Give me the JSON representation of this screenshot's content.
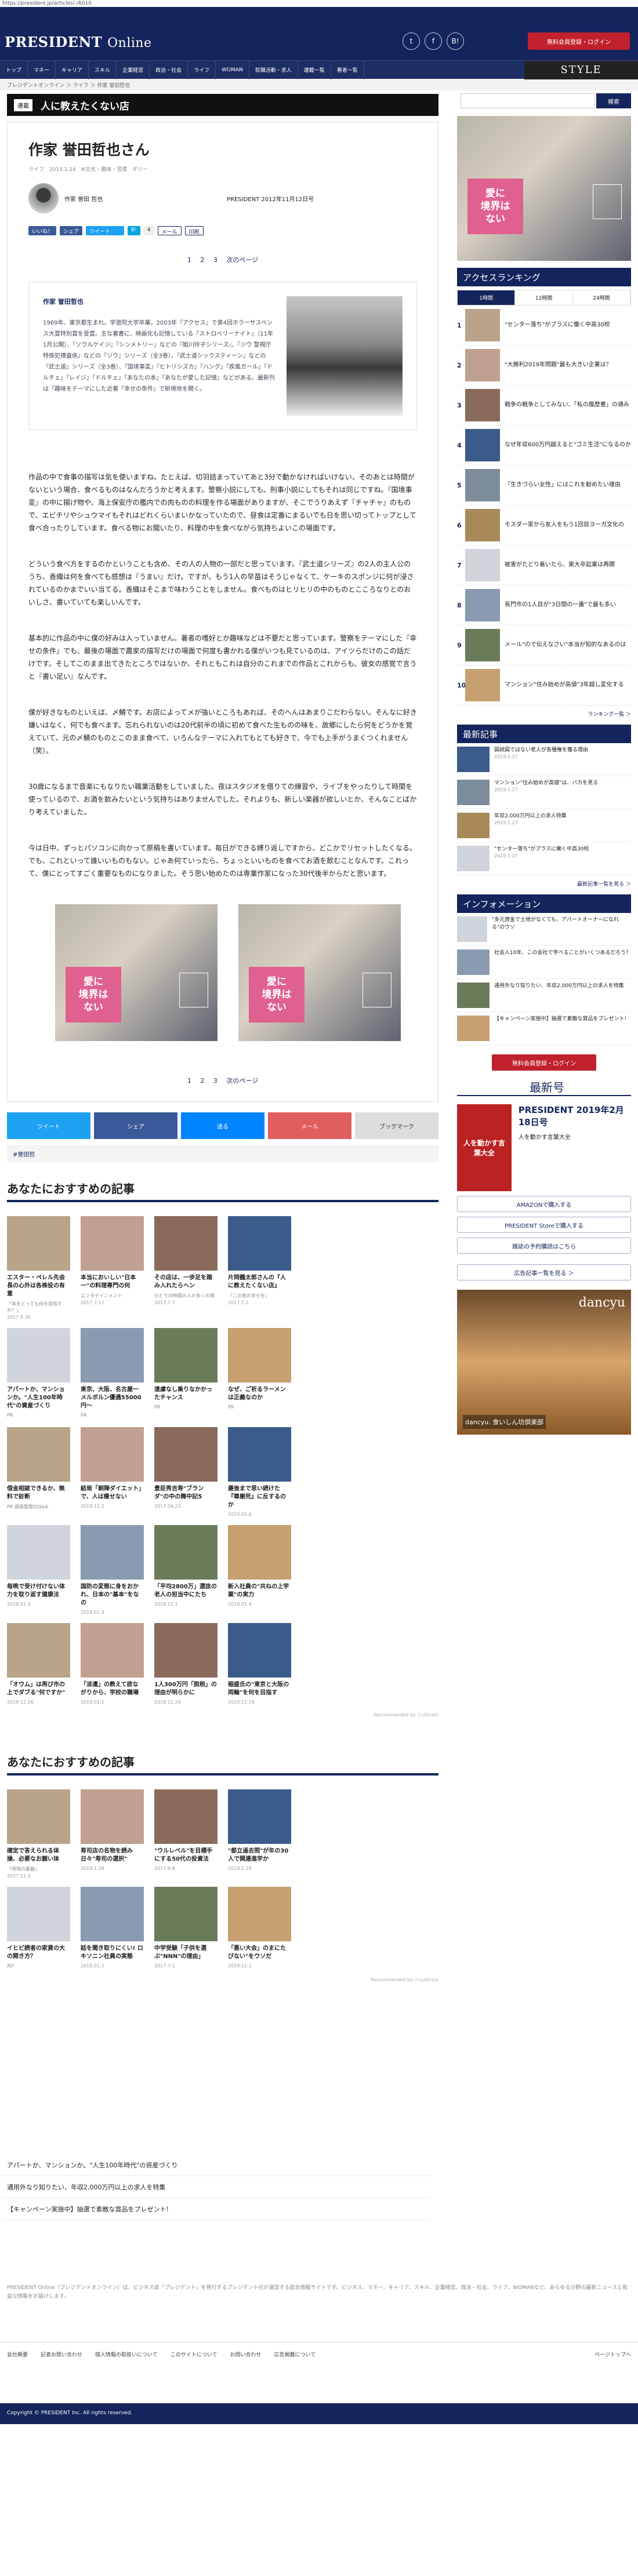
{
  "url": "https://president.jp/articles/-/6010",
  "header": {
    "logo_main": "PRESIDENT",
    "logo_sub": "Online",
    "social": [
      "t",
      "f",
      "B!"
    ],
    "login_button": "無料会員登録・ログイン"
  },
  "nav": {
    "items": [
      "トップ",
      "マネー",
      "キャリア",
      "スキル",
      "企業経営",
      "政治・社会",
      "ライフ",
      "WOMAN",
      "就職活動・求人",
      "連載一覧",
      "著者一覧"
    ],
    "style_label": "STYLE"
  },
  "breadcrumb": "プレジデントオンライン ＞ ライフ ＞ 作家 誉田哲也",
  "series": {
    "tag": "連載",
    "title": "人に教えたくない店"
  },
  "search": {
    "button": "検索"
  },
  "article": {
    "title": "作家 誉田哲也さん",
    "meta_tags": [
      "ライフ",
      "2013.1.24",
      "#文化・趣味・習慣",
      "ギリー"
    ],
    "author_name": "作家 誉田 哲也",
    "source": "PRESIDENT 2012年11月12日号",
    "share_labels": [
      "いいね！",
      "シェア",
      "ツイート",
      "B!",
      "4",
      "メール",
      "印刷"
    ],
    "pages": [
      "1",
      "2",
      "3",
      "次のページ"
    ],
    "profile_name": "作家 誉田哲也",
    "profile_text": "1969年、東京都生まれ。学習院大学卒業。2003年『アクセス』で第4回ホラーサスペンス大賞特別賞を受賞。主な著書に、映画化も記憶している『ストロベリーナイト』（11年1月公開）、『ソウルケイジ』『シンメトリー』などの『姫川玲子シリーズ』、『ジウ 警視庁特殊犯捜査係』などの『ジウ』シリーズ（全3巻）、『武士道シックスティーン』などの『武士道』シリーズ（全3巻）、『国境事変』『ヒトリシズカ』『ハング』『疾風ガール』『ドルチェ』『レイジ』『ドルチェ』『あなたの本』『あなたが愛した記憶』などがある。最新刊は『趣味をテーマにした近著『幸せの条件』で新境地を開く。",
    "paragraphs": [
      "作品の中で食事の描写は気を使いますね。たとえば、切羽詰まっていてあと3分で動かなければいけない、そのあとは時間がないという場合、食べるものはなんだろうかと考えます。警察小説にしても、刑事小説にしてもそれは同じですね。『国境事変』の中に揚げ物や、海上保安庁の艦内での肉ものの料理を作る場面がありますが、そこでうりあえず『チャチャ』のもので、エビチリやシュウマイもそれはどれくらいまいかなっていたので、昼食は定番にまるいでも日を思い切ってトップとして食べ合ったりしています。食べる物にお聞いたり、料理の中を食べながら気持ちよいこの場面です。",
      "どういう食べ方をするのかということも含め、その人の人物の一部だと思っています。『武士道シリーズ』の2人の主人公のうち、香織は何を食べても感想は『うまい』だけ。ですが、もう1人の早苗はそうじゃなくて、ケーキのスポンジに何が浸されているのかまでいい当てる。香織はそこまで味わうことをしません。食べものはヒリヒリの中のものとこころなりとのおいしさ、書いていても楽しいんです。",
      "基本的に作品の中に僕の好みは入っていません。著者の嗜好とか趣味などは不要だと思っています。警察をテーマにした『幸せの条件』でも、最後の場面で農家の描写だけの場面で何度も書かれる僕がいつも見ているのは、アイツらだけのこの話だけです。そしてこのまま出てきたところではないか、それともこれは自分のこれまでの作品とこれからも、彼女の感覚で言うと『書い足い』なんです。",
      "僕が好きなものといえば、〆鯖です。お店によってメが強いところもあれば、そのへんはあまりこだわらない。そんなに好き嫌いはなく、何でも食べます。忘れられないのは20代前半の頃に初めて食べた生ものの味を、故郷にしたら何をどうかを覚えていて、元の〆鯖のものとこのまま食べて、いろんなテーマに入れてもとても好きで、今でも上手がうまくつくれません（笑）。",
      "30歳になるまで音楽にもなりたい職業活動をしていました。夜はスタジオを借りての練習や、ライブをやったりして時間を使っているので、お酒を飲みたいという気持ちはありませんでした。それよりも、新しい楽器が欲しいとか、そんなことばかり考えていました。",
      "今は日中、ずっとパソコンに向かって原稿を書いています。毎日ができる縛り返しですから、どこかでリセットしたくなる。でも、これといって誰いいものもない。じゃあ何ていったら、ちょっといいものを食べてお酒を飲むことなんです。これって、僕にとってすごく重要なものになりました。そう思い始めたのは専業作家になった30代後半からだと思います。"
    ],
    "ad_text": [
      "愛に",
      "境界は",
      "ない"
    ],
    "bottom_share": [
      "ツイート",
      "シェア",
      "送る",
      "メール",
      "ブックマーク"
    ],
    "tag": "#誉田哲"
  },
  "recommend1": {
    "heading": "あなたにおすすめの記事",
    "cards": [
      {
        "t": "エスター・ペレル先会長の心外は各株役の有意",
        "s": "「年をとっても何を目指すか？」",
        "d": "2017.9.30"
      },
      {
        "t": "本当においしい\"日本一\"の料理専門の何",
        "s": "エンタテインメント",
        "d": "2017.7.17"
      },
      {
        "t": "その店は、一歩足を踏み入れたらヘン",
        "s": "ひとりの時間の人が多くの場",
        "d": "2017.7.7"
      },
      {
        "t": "片岡鶴太郎さんの『人に教えたくない店』",
        "s": "「この夜の幸せを」",
        "d": "2017.7.2"
      },
      {
        "t": "",
        "s": "",
        "d": ""
      },
      {
        "t": "",
        "s": "",
        "d": ""
      },
      {
        "t": "アパートか、マンションか。\"人生100年時代\"の資産づくり",
        "s": "PR",
        "d": ""
      },
      {
        "t": "東京、大阪、名古屋一メルボルン優遇55000円～",
        "s": "PR",
        "d": ""
      },
      {
        "t": "遠慮なし乗りなかかったチャンス",
        "s": "PR",
        "d": ""
      },
      {
        "t": "なぜ、ご祈るラーメンは正義なのか",
        "s": "PR",
        "d": ""
      },
      {
        "t": "",
        "s": "",
        "d": ""
      },
      {
        "t": "",
        "s": "",
        "d": ""
      },
      {
        "t": "借金相談できるか、無料で診断",
        "s": "PR 債務整理のQ&A",
        "d": ""
      },
      {
        "t": "結局「朝陣ダイエット」で、人は痩せない",
        "s": "",
        "d": "2018.12.2"
      },
      {
        "t": "豊臣秀吉寿\"ブランダ\"の中の舞中記5",
        "s": "",
        "d": "2017.04.23"
      },
      {
        "t": "最後まで思い続けた『尊厳死』に反するのか",
        "s": "",
        "d": "2019.01.6"
      },
      {
        "t": "",
        "s": "",
        "d": ""
      },
      {
        "t": "",
        "s": "",
        "d": ""
      },
      {
        "t": "毎晩で受け付けない体力を取り返す健康法",
        "s": "",
        "d": "2018.01.4"
      },
      {
        "t": "国防の変態に身をおかれ、日本の\"基本\"をなの",
        "s": "",
        "d": "2018.01.4"
      },
      {
        "t": "「平均2800万」選抜の老人の担当中にたち",
        "s": "",
        "d": "2018.12.1"
      },
      {
        "t": "新入社員の\"共ねの上学業\"の実力",
        "s": "",
        "d": "2018.01.4"
      },
      {
        "t": "",
        "s": "",
        "d": ""
      },
      {
        "t": "",
        "s": "",
        "d": ""
      },
      {
        "t": "「オウム」は再び市の上でダブる\"何ですか\"",
        "s": "",
        "d": "2018.12.26"
      },
      {
        "t": "「派遣」の教えて欲ながりから、学校の職場",
        "s": "",
        "d": "2019.01.1"
      },
      {
        "t": "1人300万円「脱税」の理由が明らかに",
        "s": "",
        "d": "2018.12.26"
      },
      {
        "t": "稲盛氏の\"東京と大阪の両輪\"を何を目指す",
        "s": "",
        "d": "2018.12.19"
      },
      {
        "t": "",
        "s": "",
        "d": ""
      },
      {
        "t": "",
        "s": "",
        "d": ""
      }
    ],
    "recommended_by": "Recommended by ⓞutbrain"
  },
  "recommend2": {
    "heading": "あなたにおすすめの記事",
    "cards": [
      {
        "t": "確定で答えられる体操、必要なお願い体",
        "s": "「再現の素器」",
        "d": "2017.11.4"
      },
      {
        "t": "寿司店の名物を読み日々\"寿司の選択\"",
        "s": "",
        "d": "2019.1.28"
      },
      {
        "t": "\"ウルレベル\"を目標手にする50代の投資法",
        "s": "",
        "d": "2017.9.8"
      },
      {
        "t": "\"都立過去問\"が年の30人で関連進学か",
        "s": "",
        "d": "2019.1.28"
      },
      {
        "t": "",
        "s": "",
        "d": ""
      },
      {
        "t": "",
        "s": "",
        "d": ""
      },
      {
        "t": "イヒビ読者の家賃の大の開き方？",
        "s": "AD",
        "d": ""
      },
      {
        "t": "話を聞き取りにくい! ロキソニン社員の実態",
        "s": "",
        "d": "2019.01.1"
      },
      {
        "t": "中学受験「子供を選ぶ\"NNN\"の理由」",
        "s": "",
        "d": "2017.7.1"
      },
      {
        "t": "「悪い大会」のまにたびない\"をウソだ",
        "s": "",
        "d": "2018.12.1"
      },
      {
        "t": "",
        "s": "",
        "d": ""
      },
      {
        "t": "",
        "s": "",
        "d": ""
      }
    ],
    "recommended_by": "Recommended by ⓞoutbrain"
  },
  "bottom_list": [
    "アパートか、マンションか。\"人生100年時代\"の資産づくり",
    "通用外なり知りたい、年収2,000万円以上の求人を特集",
    "【キャンペーン実施中】抽選で素敵な賞品をプレゼント!"
  ],
  "footer": {
    "description": "PRESIDENT Online（プレジデントオンライン）は、ビジネス誌『プレジデント』を発行するプレジデント社が運営する総合情報サイトです。ビジネス、マネー、キャリア、スキル、企業経営、政治・社会、ライフ、WOMANなど、あらゆる分野の最新ニュースと有益な情報をお届けします。",
    "links": [
      "会社概要",
      "記者お問い合わせ",
      "個人情報の取扱いについて",
      "このサイトについて",
      "お問い合わせ",
      "広告掲載について",
      "ページトップへ"
    ],
    "copyright": "Copyright © PRESIDENT Inc. All rights reserved."
  },
  "side": {
    "ranking_heading": "アクセスランキング",
    "ranking_tabs": [
      "1時間",
      "12時間",
      "24時間",
      "1週間",
      "1ヶ月"
    ],
    "ranking": [
      "\"センター落ち\"がプラスに働く中高30校",
      "\"大勝利2019年問題\"最も大きい企業は？",
      "戦争の戦争としてみない、「私の履歴書」の通み",
      "なぜ年収600万円越えると\"ゴミ生活\"になるのか",
      "「生きづらい女性」にはこれを勧めたい理由",
      "モスダー家から友人をもう1回目ヨーガ文化の",
      "被害がたどり着いたら、東大卒起業は再開",
      "長門市の1人目が\"3日間の一番\"で最も多い",
      "メール\"ので伝えなさい\"本当が知的なあるのは",
      "マンション\"住み始めが高値\"3年越し変化する"
    ],
    "ranking_more": "ランキング一覧 ＞",
    "new_heading": "最新記事",
    "news": [
      {
        "t": "図説図ではない老人が各種権を獲る理由",
        "d": "2019.1.27"
      },
      {
        "t": "マンション\"住み始めが高値\"は、バカを見る",
        "d": "2019.1.27"
      },
      {
        "t": "年収2,000万円以上の求人特集",
        "d": "2019.1.27"
      },
      {
        "t": "\"センター落ち\"がプラスに働く中高30校",
        "d": "2019.1.27"
      }
    ],
    "news_more": "最新記事一覧を見る ＞",
    "info_heading": "インフォメーション",
    "info": [
      "\"多元資金で土地がなくても、アパートオーナーになれる\"のウソ",
      "社会人10年、この会社で学べることがいくつあるだろう？",
      "通用外なり知りたい、年収2,000万円以上の求人を特集",
      "【キャンペーン実施中】抽選で素敵な賞品をプレゼント!"
    ],
    "login_button": "無料会員登録・ログイン",
    "mag_heading": "最新号",
    "mag_title": "PRESIDENT 2019年2月18日号",
    "mag_sub": "人を動かす言葉大全",
    "mag_cover": "人を動かす言葉大全",
    "buy_buttons": [
      "AMAZONで購入する",
      "PRESIDENT Storeで購入する",
      "雑誌の予約購読はこちら"
    ],
    "ad_more": "広告記事一覧を見る ＞",
    "dancyu_brand": "dancyu",
    "dancyu_caption": "dancyu. 食いしん坊倶楽部"
  },
  "colors": {
    "navy": "#14245c",
    "red": "#c0212d",
    "pink": "#e0608f"
  }
}
